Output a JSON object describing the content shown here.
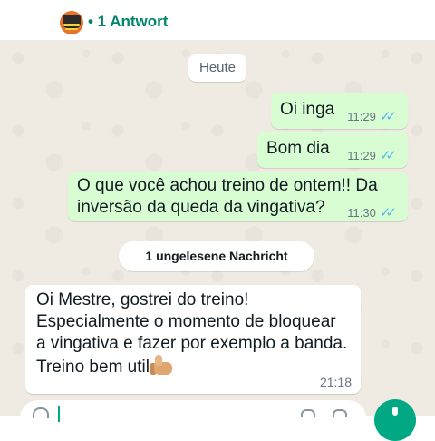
{
  "header": {
    "replies_label": "• 1 Antwort",
    "avatar_icon": "group-avatar"
  },
  "chat": {
    "date_chip": "Heute",
    "outgoing": [
      {
        "text": "Oi inga",
        "time": "11:29",
        "status_icon": "double-check-read"
      },
      {
        "text": "Bom dia",
        "time": "11:29",
        "status_icon": "double-check-read"
      },
      {
        "text": "O que você achou treino de ontem!! Da inversão da queda da vingativa?",
        "time": "11:30",
        "status_icon": "double-check-read"
      }
    ],
    "unread_banner": "1 ungelesene Nachricht",
    "incoming": {
      "lines": [
        "Oi Mestre, gostrei do treino!",
        "Especialmente o momento de bloquear",
        "a vingativa e fazer por exemplo a banda.",
        "Treino bem util"
      ],
      "emoji": "thumbs-up",
      "time": "21:18"
    }
  },
  "colors": {
    "accent": "#00a884",
    "outgoing_bubble": "#d9fdd3",
    "read_ticks": "#53bdeb",
    "chat_background": "#efeae2"
  }
}
